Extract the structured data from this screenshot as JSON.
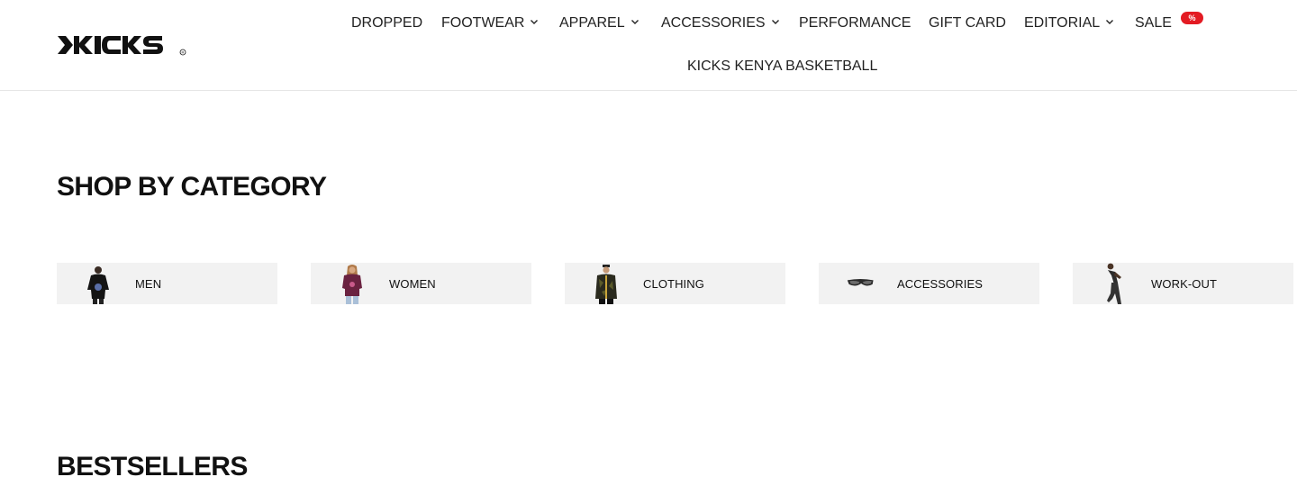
{
  "brand": {
    "name": "KICKS"
  },
  "nav": {
    "items": [
      {
        "label": "DROPPED",
        "has_dropdown": false
      },
      {
        "label": "FOOTWEAR",
        "has_dropdown": true
      },
      {
        "label": "APPAREL",
        "has_dropdown": true
      },
      {
        "label": "ACCESSORIES",
        "has_dropdown": true
      },
      {
        "label": "PERFORMANCE",
        "has_dropdown": false
      },
      {
        "label": "GIFT CARD",
        "has_dropdown": false
      },
      {
        "label": "EDITORIAL",
        "has_dropdown": true
      },
      {
        "label": "SALE",
        "has_dropdown": false
      },
      {
        "label": "KICKS KENYA BASKETBALL",
        "has_dropdown": false
      }
    ],
    "sale_badge": "%",
    "sale_badge_color": "#e31b23"
  },
  "categories": {
    "title": "SHOP BY CATEGORY",
    "items": [
      {
        "label": "MEN",
        "icon": "men-model-image"
      },
      {
        "label": "WOMEN",
        "icon": "women-model-image"
      },
      {
        "label": "CLOTHING",
        "icon": "clothing-model-image"
      },
      {
        "label": "ACCESSORIES",
        "icon": "sunglasses-image"
      },
      {
        "label": "WORK-OUT",
        "icon": "workout-model-image"
      }
    ]
  },
  "bestsellers": {
    "title": "BESTSELLERS"
  }
}
